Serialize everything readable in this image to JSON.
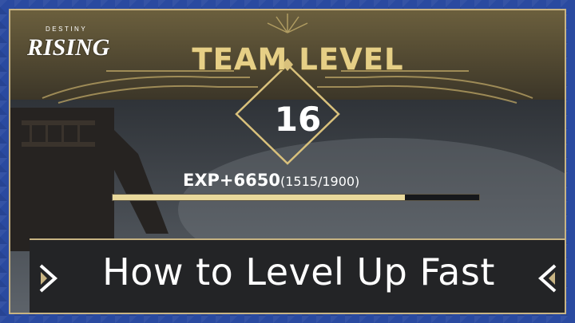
{
  "brand": {
    "small_text": "DESTINY",
    "name": "RISING"
  },
  "team_level": {
    "title": "TEAM LEVEL",
    "level": "16"
  },
  "experience": {
    "gain_label": "EXP+6650",
    "progress_label": "(1515/1900)",
    "current": 1515,
    "max": 1900
  },
  "banner": {
    "title": "How to Level Up Fast"
  },
  "icons": {
    "left_chevron": "chevron-right-icon",
    "right_chevron": "chevron-left-icon"
  },
  "colors": {
    "frame_blue": "#2a4aa0",
    "gold": "#e6cf86",
    "bar_fill": "#e9d99c",
    "text": "#ffffff"
  }
}
